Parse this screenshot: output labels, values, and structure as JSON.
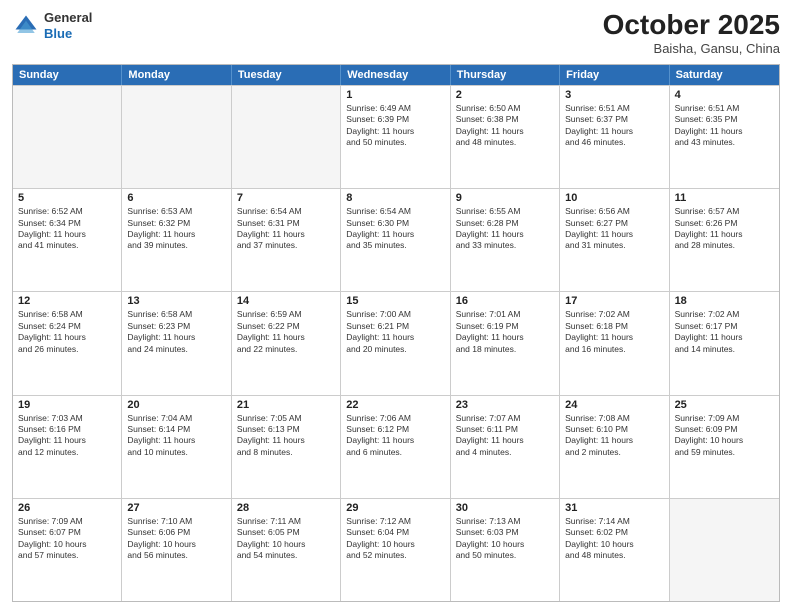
{
  "header": {
    "logo_general": "General",
    "logo_blue": "Blue",
    "month": "October 2025",
    "location": "Baisha, Gansu, China"
  },
  "weekdays": [
    "Sunday",
    "Monday",
    "Tuesday",
    "Wednesday",
    "Thursday",
    "Friday",
    "Saturday"
  ],
  "rows": [
    [
      {
        "day": "",
        "lines": []
      },
      {
        "day": "",
        "lines": []
      },
      {
        "day": "",
        "lines": []
      },
      {
        "day": "1",
        "lines": [
          "Sunrise: 6:49 AM",
          "Sunset: 6:39 PM",
          "Daylight: 11 hours",
          "and 50 minutes."
        ]
      },
      {
        "day": "2",
        "lines": [
          "Sunrise: 6:50 AM",
          "Sunset: 6:38 PM",
          "Daylight: 11 hours",
          "and 48 minutes."
        ]
      },
      {
        "day": "3",
        "lines": [
          "Sunrise: 6:51 AM",
          "Sunset: 6:37 PM",
          "Daylight: 11 hours",
          "and 46 minutes."
        ]
      },
      {
        "day": "4",
        "lines": [
          "Sunrise: 6:51 AM",
          "Sunset: 6:35 PM",
          "Daylight: 11 hours",
          "and 43 minutes."
        ]
      }
    ],
    [
      {
        "day": "5",
        "lines": [
          "Sunrise: 6:52 AM",
          "Sunset: 6:34 PM",
          "Daylight: 11 hours",
          "and 41 minutes."
        ]
      },
      {
        "day": "6",
        "lines": [
          "Sunrise: 6:53 AM",
          "Sunset: 6:32 PM",
          "Daylight: 11 hours",
          "and 39 minutes."
        ]
      },
      {
        "day": "7",
        "lines": [
          "Sunrise: 6:54 AM",
          "Sunset: 6:31 PM",
          "Daylight: 11 hours",
          "and 37 minutes."
        ]
      },
      {
        "day": "8",
        "lines": [
          "Sunrise: 6:54 AM",
          "Sunset: 6:30 PM",
          "Daylight: 11 hours",
          "and 35 minutes."
        ]
      },
      {
        "day": "9",
        "lines": [
          "Sunrise: 6:55 AM",
          "Sunset: 6:28 PM",
          "Daylight: 11 hours",
          "and 33 minutes."
        ]
      },
      {
        "day": "10",
        "lines": [
          "Sunrise: 6:56 AM",
          "Sunset: 6:27 PM",
          "Daylight: 11 hours",
          "and 31 minutes."
        ]
      },
      {
        "day": "11",
        "lines": [
          "Sunrise: 6:57 AM",
          "Sunset: 6:26 PM",
          "Daylight: 11 hours",
          "and 28 minutes."
        ]
      }
    ],
    [
      {
        "day": "12",
        "lines": [
          "Sunrise: 6:58 AM",
          "Sunset: 6:24 PM",
          "Daylight: 11 hours",
          "and 26 minutes."
        ]
      },
      {
        "day": "13",
        "lines": [
          "Sunrise: 6:58 AM",
          "Sunset: 6:23 PM",
          "Daylight: 11 hours",
          "and 24 minutes."
        ]
      },
      {
        "day": "14",
        "lines": [
          "Sunrise: 6:59 AM",
          "Sunset: 6:22 PM",
          "Daylight: 11 hours",
          "and 22 minutes."
        ]
      },
      {
        "day": "15",
        "lines": [
          "Sunrise: 7:00 AM",
          "Sunset: 6:21 PM",
          "Daylight: 11 hours",
          "and 20 minutes."
        ]
      },
      {
        "day": "16",
        "lines": [
          "Sunrise: 7:01 AM",
          "Sunset: 6:19 PM",
          "Daylight: 11 hours",
          "and 18 minutes."
        ]
      },
      {
        "day": "17",
        "lines": [
          "Sunrise: 7:02 AM",
          "Sunset: 6:18 PM",
          "Daylight: 11 hours",
          "and 16 minutes."
        ]
      },
      {
        "day": "18",
        "lines": [
          "Sunrise: 7:02 AM",
          "Sunset: 6:17 PM",
          "Daylight: 11 hours",
          "and 14 minutes."
        ]
      }
    ],
    [
      {
        "day": "19",
        "lines": [
          "Sunrise: 7:03 AM",
          "Sunset: 6:16 PM",
          "Daylight: 11 hours",
          "and 12 minutes."
        ]
      },
      {
        "day": "20",
        "lines": [
          "Sunrise: 7:04 AM",
          "Sunset: 6:14 PM",
          "Daylight: 11 hours",
          "and 10 minutes."
        ]
      },
      {
        "day": "21",
        "lines": [
          "Sunrise: 7:05 AM",
          "Sunset: 6:13 PM",
          "Daylight: 11 hours",
          "and 8 minutes."
        ]
      },
      {
        "day": "22",
        "lines": [
          "Sunrise: 7:06 AM",
          "Sunset: 6:12 PM",
          "Daylight: 11 hours",
          "and 6 minutes."
        ]
      },
      {
        "day": "23",
        "lines": [
          "Sunrise: 7:07 AM",
          "Sunset: 6:11 PM",
          "Daylight: 11 hours",
          "and 4 minutes."
        ]
      },
      {
        "day": "24",
        "lines": [
          "Sunrise: 7:08 AM",
          "Sunset: 6:10 PM",
          "Daylight: 11 hours",
          "and 2 minutes."
        ]
      },
      {
        "day": "25",
        "lines": [
          "Sunrise: 7:09 AM",
          "Sunset: 6:09 PM",
          "Daylight: 10 hours",
          "and 59 minutes."
        ]
      }
    ],
    [
      {
        "day": "26",
        "lines": [
          "Sunrise: 7:09 AM",
          "Sunset: 6:07 PM",
          "Daylight: 10 hours",
          "and 57 minutes."
        ]
      },
      {
        "day": "27",
        "lines": [
          "Sunrise: 7:10 AM",
          "Sunset: 6:06 PM",
          "Daylight: 10 hours",
          "and 56 minutes."
        ]
      },
      {
        "day": "28",
        "lines": [
          "Sunrise: 7:11 AM",
          "Sunset: 6:05 PM",
          "Daylight: 10 hours",
          "and 54 minutes."
        ]
      },
      {
        "day": "29",
        "lines": [
          "Sunrise: 7:12 AM",
          "Sunset: 6:04 PM",
          "Daylight: 10 hours",
          "and 52 minutes."
        ]
      },
      {
        "day": "30",
        "lines": [
          "Sunrise: 7:13 AM",
          "Sunset: 6:03 PM",
          "Daylight: 10 hours",
          "and 50 minutes."
        ]
      },
      {
        "day": "31",
        "lines": [
          "Sunrise: 7:14 AM",
          "Sunset: 6:02 PM",
          "Daylight: 10 hours",
          "and 48 minutes."
        ]
      },
      {
        "day": "",
        "lines": []
      }
    ]
  ]
}
